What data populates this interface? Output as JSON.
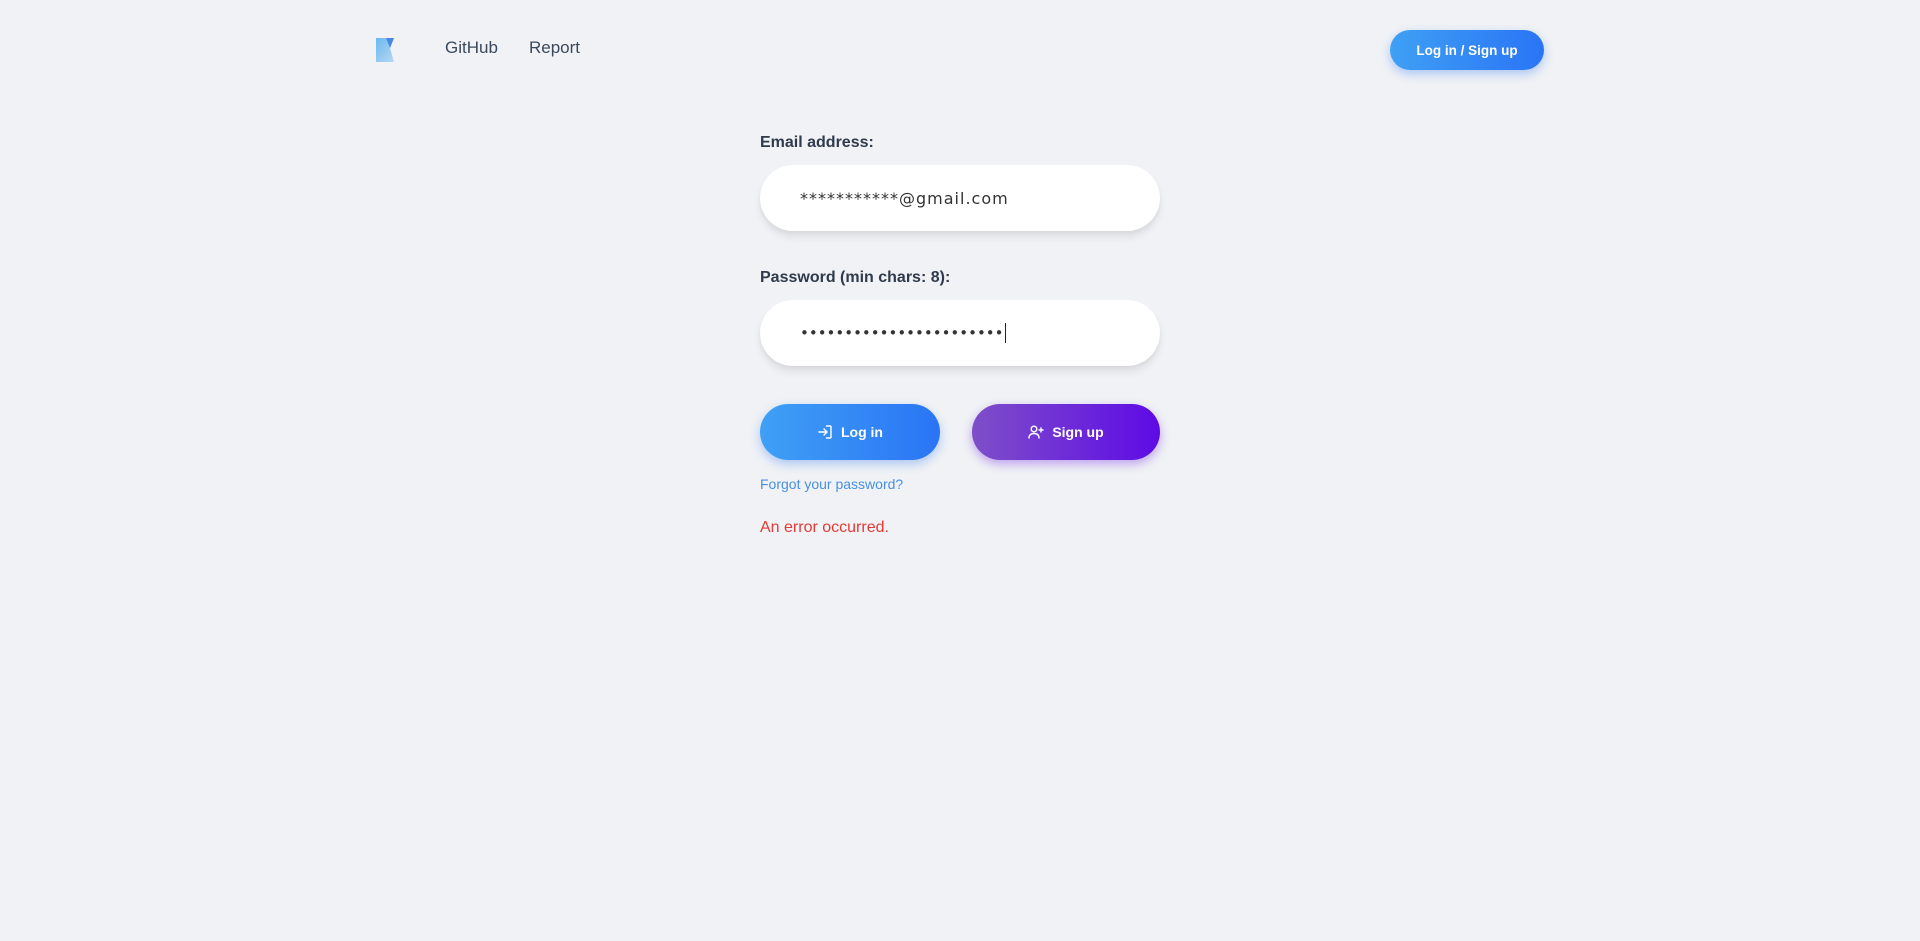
{
  "header": {
    "nav": {
      "github_label": "GitHub",
      "report_label": "Report"
    },
    "auth_button_label": "Log in / Sign up"
  },
  "form": {
    "email": {
      "label": "Email address:",
      "value": "***********@gmail.com"
    },
    "password": {
      "label": "Password (min chars: 8):",
      "value": "•••••••••••••••••••••••"
    },
    "login_button_label": "Log in",
    "signup_button_label": "Sign up",
    "forgot_link_label": "Forgot your password?",
    "error_message": "An error occurred."
  },
  "colors": {
    "background": "#f0f2f5",
    "primary_gradient_start": "#3fa0f5",
    "primary_gradient_end": "#2a74f5",
    "secondary_gradient_start": "#7e4fc8",
    "secondary_gradient_end": "#5e0ae6",
    "link": "#4a90e2",
    "error": "#e53935"
  },
  "icons": {
    "logo": "app-logo",
    "login": "login-arrow-icon",
    "signup": "user-plus-icon"
  }
}
